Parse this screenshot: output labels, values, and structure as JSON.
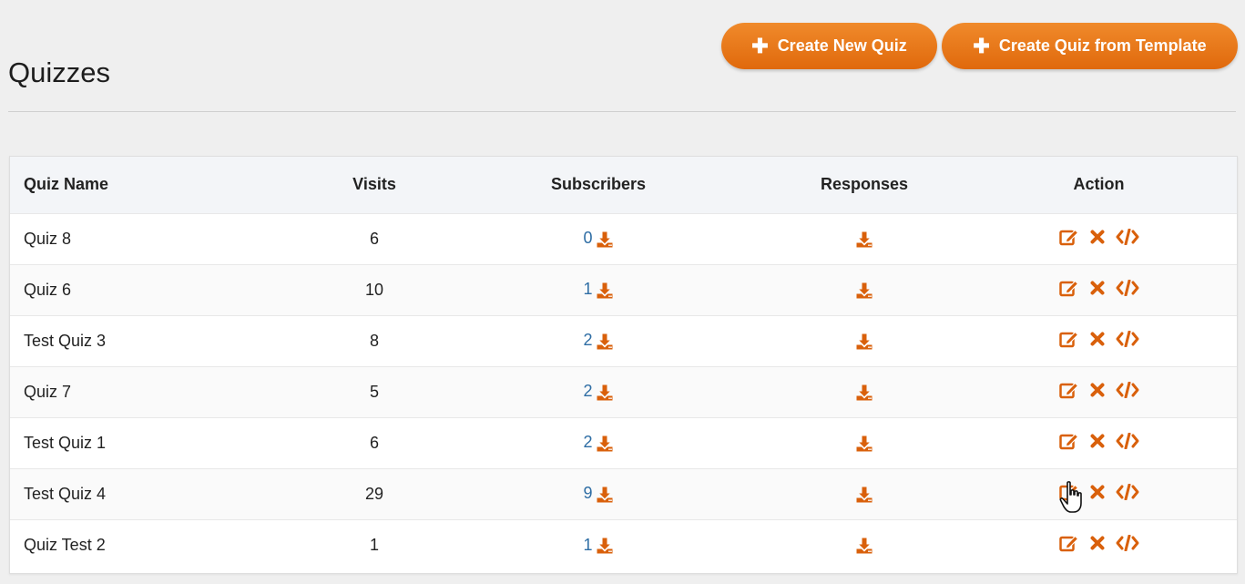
{
  "page": {
    "title": "Quizzes"
  },
  "toolbar": {
    "create_new_label": "Create New Quiz",
    "create_template_label": "Create Quiz from Template"
  },
  "table": {
    "headers": {
      "name": "Quiz Name",
      "visits": "Visits",
      "subscribers": "Subscribers",
      "responses": "Responses",
      "action": "Action"
    },
    "rows": [
      {
        "name": "Quiz 8",
        "visits": "6",
        "subscribers": "0"
      },
      {
        "name": "Quiz 6",
        "visits": "10",
        "subscribers": "1"
      },
      {
        "name": "Test Quiz 3",
        "visits": "8",
        "subscribers": "2"
      },
      {
        "name": "Quiz 7",
        "visits": "5",
        "subscribers": "2"
      },
      {
        "name": "Test Quiz 1",
        "visits": "6",
        "subscribers": "2"
      },
      {
        "name": "Test Quiz 4",
        "visits": "29",
        "subscribers": "9"
      },
      {
        "name": "Quiz Test 2",
        "visits": "1",
        "subscribers": "1"
      }
    ]
  },
  "icons": {
    "plus": "plus-icon",
    "download": "download-icon",
    "edit": "edit-icon",
    "delete": "close-icon",
    "embed": "code-icon"
  },
  "colors": {
    "accent": "#e8720f",
    "icon": "#d9600b",
    "link": "#2e6da4",
    "background": "#efefef"
  }
}
